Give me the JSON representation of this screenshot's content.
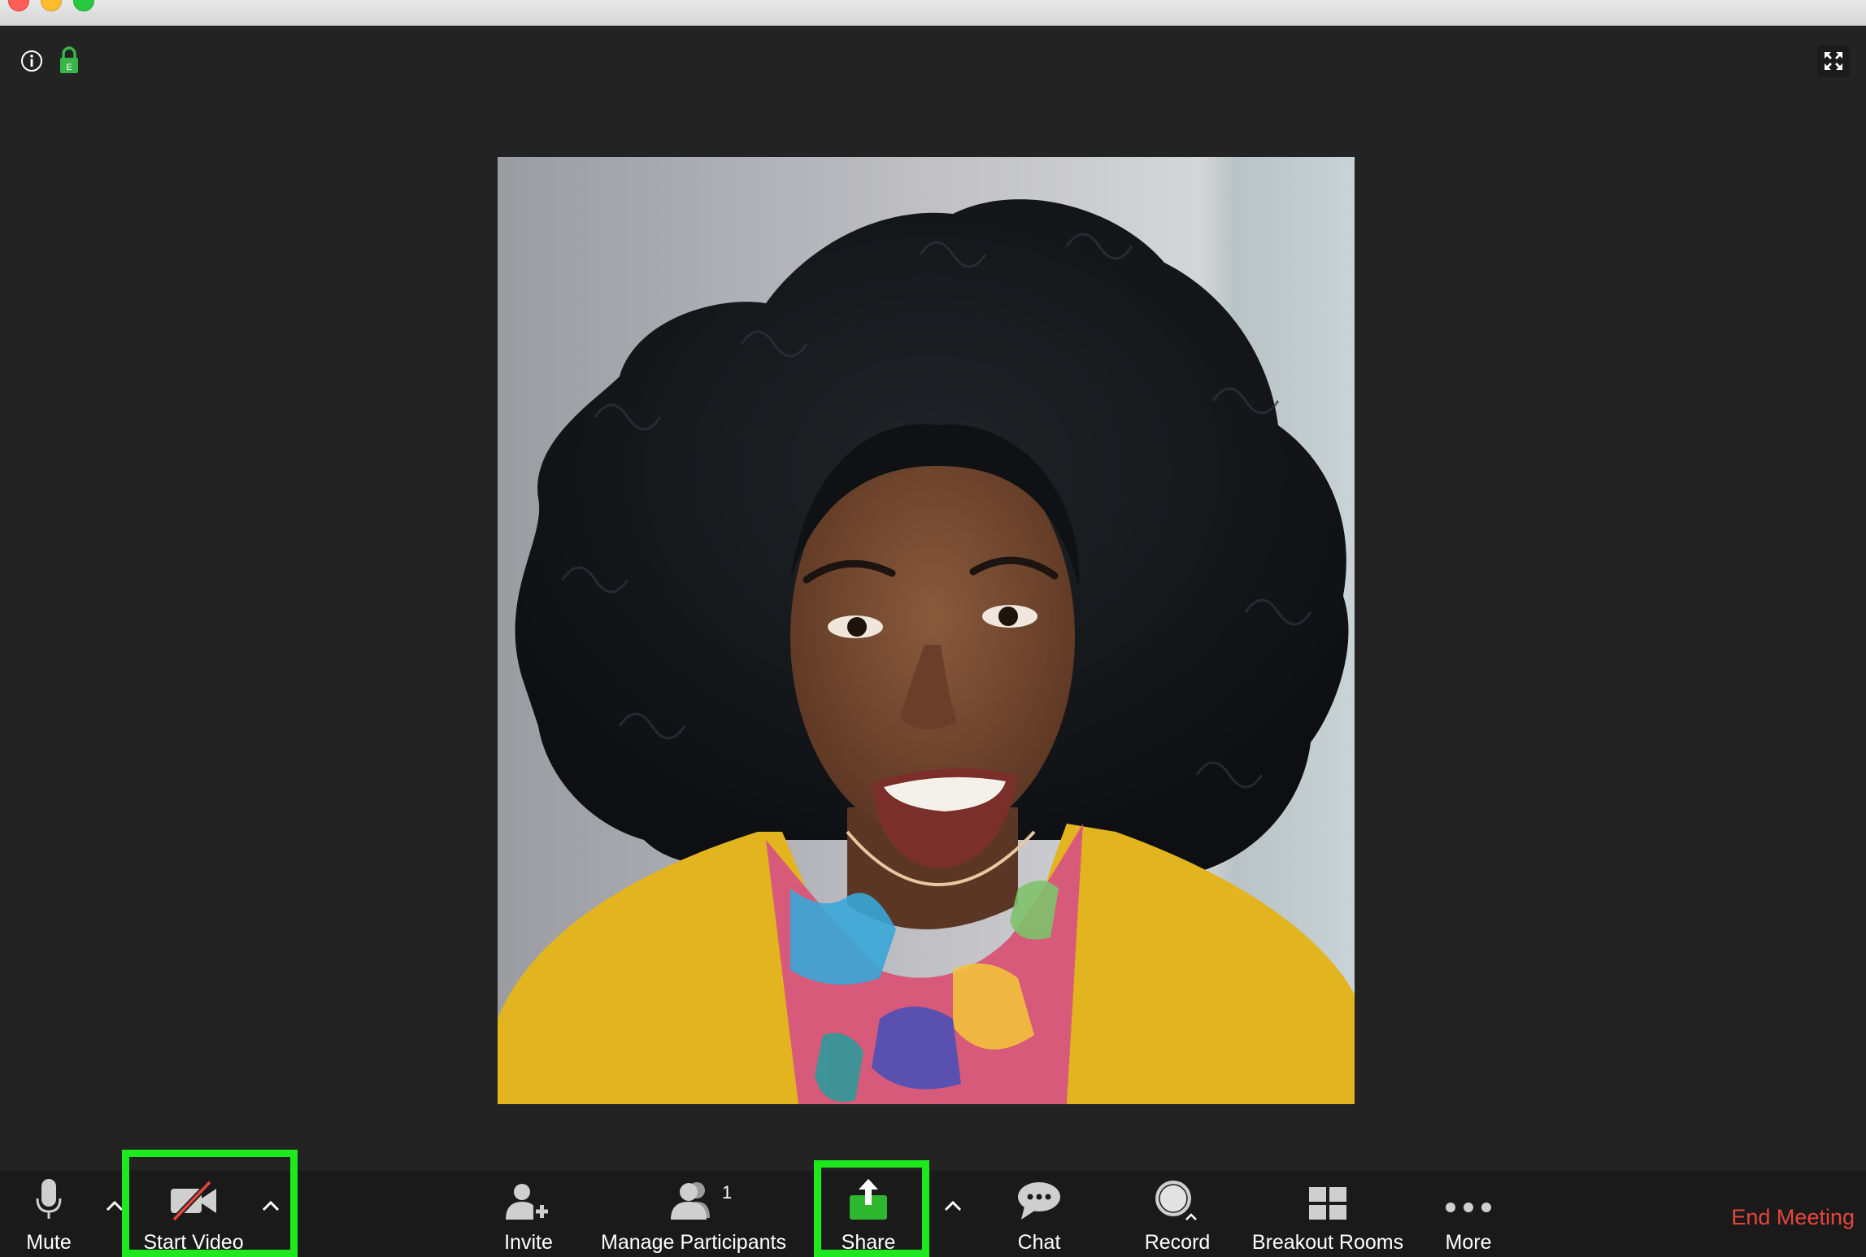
{
  "window": {
    "title": ""
  },
  "toolbar": {
    "mute_label": "Mute",
    "start_video_label": "Start Video",
    "invite_label": "Invite",
    "manage_participants_label": "Manage Participants",
    "participant_count": "1",
    "share_label": "Share",
    "chat_label": "Chat",
    "record_label": "Record",
    "breakout_rooms_label": "Breakout Rooms",
    "more_label": "More",
    "end_meeting_label": "End Meeting"
  },
  "icons": {
    "info": "info-icon",
    "lock": "encryption-lock-icon",
    "lock_letter": "E",
    "fullscreen": "fullscreen-icon",
    "mute": "microphone-icon",
    "video": "video-off-icon",
    "invite": "add-user-icon",
    "participants": "participants-icon",
    "share": "share-screen-icon",
    "chat": "chat-bubble-icon",
    "record": "record-icon",
    "breakout": "grid-icon",
    "more": "ellipsis-icon"
  },
  "colors": {
    "background": "#232323",
    "toolbar": "#1a1a1a",
    "highlight": "#1ee81e",
    "share_green": "#2fb62f",
    "lock_green": "#39b54a",
    "end_meeting_red": "#e8453c",
    "video_slash_red": "#e8453c"
  }
}
